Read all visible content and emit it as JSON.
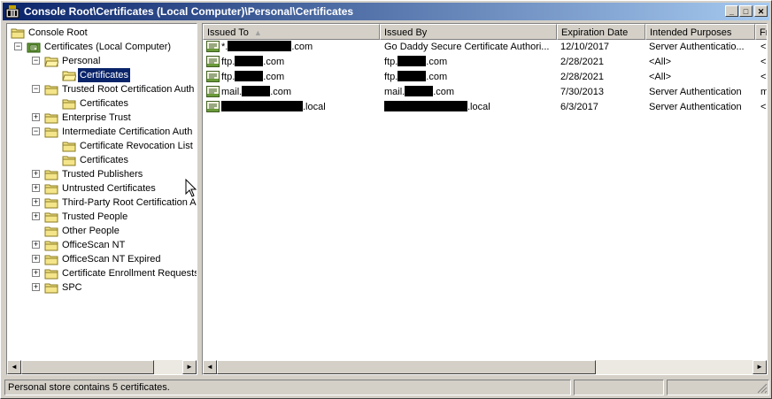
{
  "window": {
    "title": "Console Root\\Certificates (Local Computer)\\Personal\\Certificates",
    "minimize": "_",
    "maximize": "□",
    "close": "✕"
  },
  "tree": [
    {
      "label": "Console Root",
      "level": 0,
      "expander": "",
      "icon": "folder-icon"
    },
    {
      "label": "Certificates (Local Computer)",
      "level": 1,
      "expander": "−",
      "icon": "certificates-snapin-icon"
    },
    {
      "label": "Personal",
      "level": 2,
      "expander": "−",
      "icon": "folder-open-icon"
    },
    {
      "label": "Certificates",
      "level": 3,
      "expander": "",
      "icon": "folder-open-icon",
      "selected": true
    },
    {
      "label": "Trusted Root Certification Auth",
      "level": 2,
      "expander": "−",
      "icon": "folder-icon"
    },
    {
      "label": "Certificates",
      "level": 3,
      "expander": "",
      "icon": "folder-icon"
    },
    {
      "label": "Enterprise Trust",
      "level": 2,
      "expander": "+",
      "icon": "folder-icon"
    },
    {
      "label": "Intermediate Certification Auth",
      "level": 2,
      "expander": "−",
      "icon": "folder-icon"
    },
    {
      "label": "Certificate Revocation List",
      "level": 3,
      "expander": "",
      "icon": "folder-icon"
    },
    {
      "label": "Certificates",
      "level": 3,
      "expander": "",
      "icon": "folder-icon"
    },
    {
      "label": "Trusted Publishers",
      "level": 2,
      "expander": "+",
      "icon": "folder-icon"
    },
    {
      "label": "Untrusted Certificates",
      "level": 2,
      "expander": "+",
      "icon": "folder-icon"
    },
    {
      "label": "Third-Party Root Certification A",
      "level": 2,
      "expander": "+",
      "icon": "folder-icon"
    },
    {
      "label": "Trusted People",
      "level": 2,
      "expander": "+",
      "icon": "folder-icon"
    },
    {
      "label": "Other People",
      "level": 2,
      "expander": "",
      "icon": "folder-icon"
    },
    {
      "label": "OfficeScan NT",
      "level": 2,
      "expander": "+",
      "icon": "folder-icon"
    },
    {
      "label": "OfficeScan NT Expired",
      "level": 2,
      "expander": "+",
      "icon": "folder-icon"
    },
    {
      "label": "Certificate Enrollment Requests",
      "level": 2,
      "expander": "+",
      "icon": "folder-icon"
    },
    {
      "label": "SPC",
      "level": 2,
      "expander": "+",
      "icon": "folder-icon"
    }
  ],
  "list": {
    "columns": [
      "Issued To",
      "Issued By",
      "Expiration Date",
      "Intended Purposes",
      "Fr"
    ],
    "sort_indicator": "▲",
    "rows": [
      {
        "issued_to": [
          "*.",
          ".com"
        ],
        "issued_by": [
          "Go Daddy Secure Certificate Authori..."
        ],
        "expiration": "12/10/2017",
        "purposes": "Server Authenticatio...",
        "fr": "<"
      },
      {
        "issued_to": [
          "ftp.",
          ".com"
        ],
        "issued_by": [
          "ftp.",
          ".com"
        ],
        "expiration": "2/28/2021",
        "purposes": "<All>",
        "fr": "<"
      },
      {
        "issued_to": [
          "ftp.",
          ".com"
        ],
        "issued_by": [
          "ftp.",
          ".com"
        ],
        "expiration": "2/28/2021",
        "purposes": "<All>",
        "fr": "<"
      },
      {
        "issued_to": [
          "mail.",
          ".com"
        ],
        "issued_by": [
          "mail.",
          ".com"
        ],
        "expiration": "7/30/2013",
        "purposes": "Server Authentication",
        "fr": "m"
      },
      {
        "issued_to": [
          "",
          ".local"
        ],
        "issued_by": [
          "",
          ".local"
        ],
        "expiration": "6/3/2017",
        "purposes": "Server Authentication",
        "fr": "<"
      }
    ]
  },
  "status": {
    "text": "Personal store contains 5 certificates."
  },
  "icons": {
    "scroll_left": "◄",
    "scroll_right": "►"
  }
}
